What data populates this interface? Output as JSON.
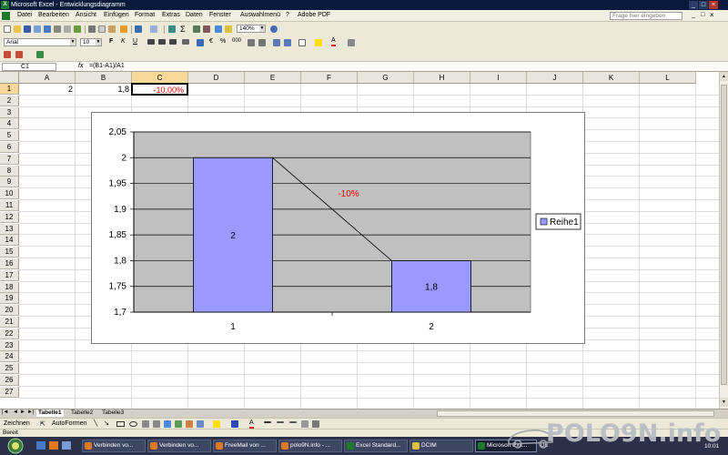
{
  "window": {
    "title": "Microsoft Excel - Entwicklungsdiagramm"
  },
  "menu": {
    "items": [
      "Datei",
      "Bearbeiten",
      "Ansicht",
      "Einfügen",
      "Format",
      "Extras",
      "Daten",
      "Fenster",
      "Auswahlmenü",
      "?",
      "Adobe PDF"
    ],
    "help_placeholder": "Frage hier eingeben"
  },
  "toolbar": {
    "zoom": "140%",
    "font_name": "Arial",
    "font_size": "10"
  },
  "formula": {
    "cell_ref": "C1",
    "fx": "fx",
    "formula": "=(B1-A1)/A1"
  },
  "grid": {
    "columns": [
      "A",
      "B",
      "C",
      "D",
      "E",
      "F",
      "G",
      "H",
      "I",
      "J",
      "K",
      "L"
    ],
    "rows": [
      "1",
      "2",
      "3",
      "4",
      "5",
      "6",
      "7",
      "8",
      "9",
      "10",
      "11",
      "12",
      "13",
      "14",
      "15",
      "16",
      "17",
      "18",
      "19",
      "20",
      "21",
      "22",
      "23",
      "24",
      "25",
      "26",
      "27"
    ],
    "cells": {
      "A1": "2",
      "B1": "1,8",
      "C1": "-10,00%"
    },
    "negative_color": "#ff0000"
  },
  "chart_data": {
    "type": "bar",
    "categories": [
      "1",
      "2"
    ],
    "series": [
      {
        "name": "Reihe1",
        "values": [
          2,
          1.8
        ],
        "color": "#9999ff"
      }
    ],
    "data_labels": [
      "2",
      "1,8"
    ],
    "annotation": "-10%",
    "annotation_color": "#ff0000",
    "ylim": [
      1.7,
      2.05
    ],
    "yticks": [
      "1,7",
      "1,75",
      "1,8",
      "1,85",
      "1,9",
      "1,95",
      "2",
      "2,05"
    ],
    "ytick_values": [
      1.7,
      1.75,
      1.8,
      1.85,
      1.9,
      1.95,
      2,
      2.05
    ],
    "plot_background": "#c0c0c0",
    "grid": true,
    "legend": "right"
  },
  "sheets": {
    "tabs": [
      "Tabelle1",
      "Tabelle2",
      "Tabelle3"
    ],
    "active": "Tabelle1"
  },
  "drawing": {
    "zeichnen": "Zeichnen",
    "autoformen": "AutoFormen"
  },
  "status": {
    "text": "Bereit"
  },
  "taskbar": {
    "items": [
      "Verbinden vo...",
      "Verbinden vo...",
      "FreeMail von ...",
      "polo9N.info - ...",
      "Excel Standard...",
      "DCIM",
      "Microsoft Exc..."
    ],
    "active": "Microsoft Exc...",
    "lang": "DE",
    "clock": "10:01"
  },
  "watermark": {
    "text": "POLO9N.info"
  }
}
